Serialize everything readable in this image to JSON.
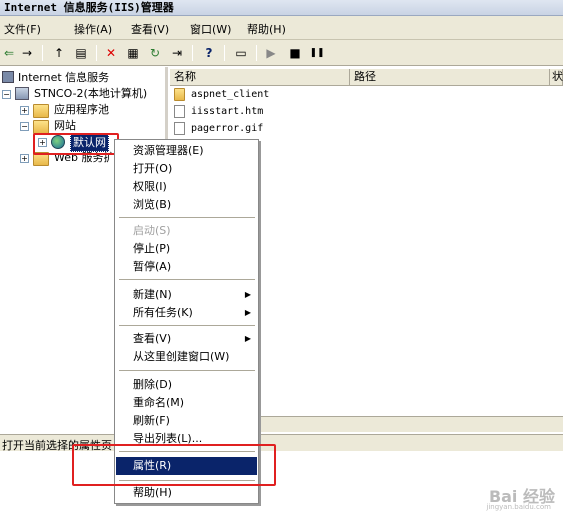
{
  "window": {
    "title": "Internet 信息服务(IIS)管理器"
  },
  "menu": [
    "文件(F)",
    "操作(A)",
    "查看(V)",
    "窗口(W)",
    "帮助(H)"
  ],
  "toolbar": {
    "icons": [
      "back-icon",
      "forward-icon",
      "up-folder-icon",
      "show-hide-tree-icon",
      "delete-icon",
      "properties-icon",
      "refresh-icon",
      "export-list-icon",
      "help-icon",
      "computer-icon",
      "play-icon",
      "stop-icon",
      "pause-icon"
    ],
    "glyphs": [
      "⇐",
      "→",
      "↑",
      "▤",
      "✕",
      "▦",
      "↻",
      "⇥",
      "?",
      "▭",
      "▶",
      "■",
      "❚❚"
    ]
  },
  "tree": {
    "root": "Internet 信息服务",
    "computer": "STNCO-2(本地计算机)",
    "app_pools": "应用程序池",
    "websites": "网站",
    "default_site": "默认网",
    "web_ext": "Web 服务扩"
  },
  "list": {
    "columns": [
      "名称",
      "路径",
      "状"
    ],
    "files": [
      "aspnet_client",
      "iisstart.htm",
      "pagerror.gif"
    ]
  },
  "context_menu": {
    "items": [
      {
        "label": "资源管理器(E)",
        "disabled": false
      },
      {
        "label": "打开(O)",
        "disabled": false
      },
      {
        "label": "权限(I)",
        "disabled": false
      },
      {
        "label": "浏览(B)",
        "disabled": false
      },
      {
        "label": "启动(S)",
        "disabled": true
      },
      {
        "label": "停止(P)",
        "disabled": false
      },
      {
        "label": "暂停(A)",
        "disabled": false
      },
      {
        "label": "新建(N)",
        "disabled": false,
        "submenu": true
      },
      {
        "label": "所有任务(K)",
        "disabled": false,
        "submenu": true
      },
      {
        "label": "查看(V)",
        "disabled": false,
        "submenu": true
      },
      {
        "label": "从这里创建窗口(W)",
        "disabled": false
      },
      {
        "label": "删除(D)",
        "disabled": false
      },
      {
        "label": "重命名(M)",
        "disabled": false
      },
      {
        "label": "刷新(F)",
        "disabled": false
      },
      {
        "label": "导出列表(L)...",
        "disabled": false
      },
      {
        "label": "属性(R)",
        "disabled": false,
        "selected": true
      },
      {
        "label": "帮助(H)",
        "disabled": false
      }
    ]
  },
  "status": {
    "text": "打开当前选择的属性页"
  },
  "watermark": {
    "text": "Bai 经验",
    "sub": "jingyan.baidu.com"
  },
  "colors": {
    "selection": "#0a246a",
    "highlight_box": "#e02020"
  }
}
